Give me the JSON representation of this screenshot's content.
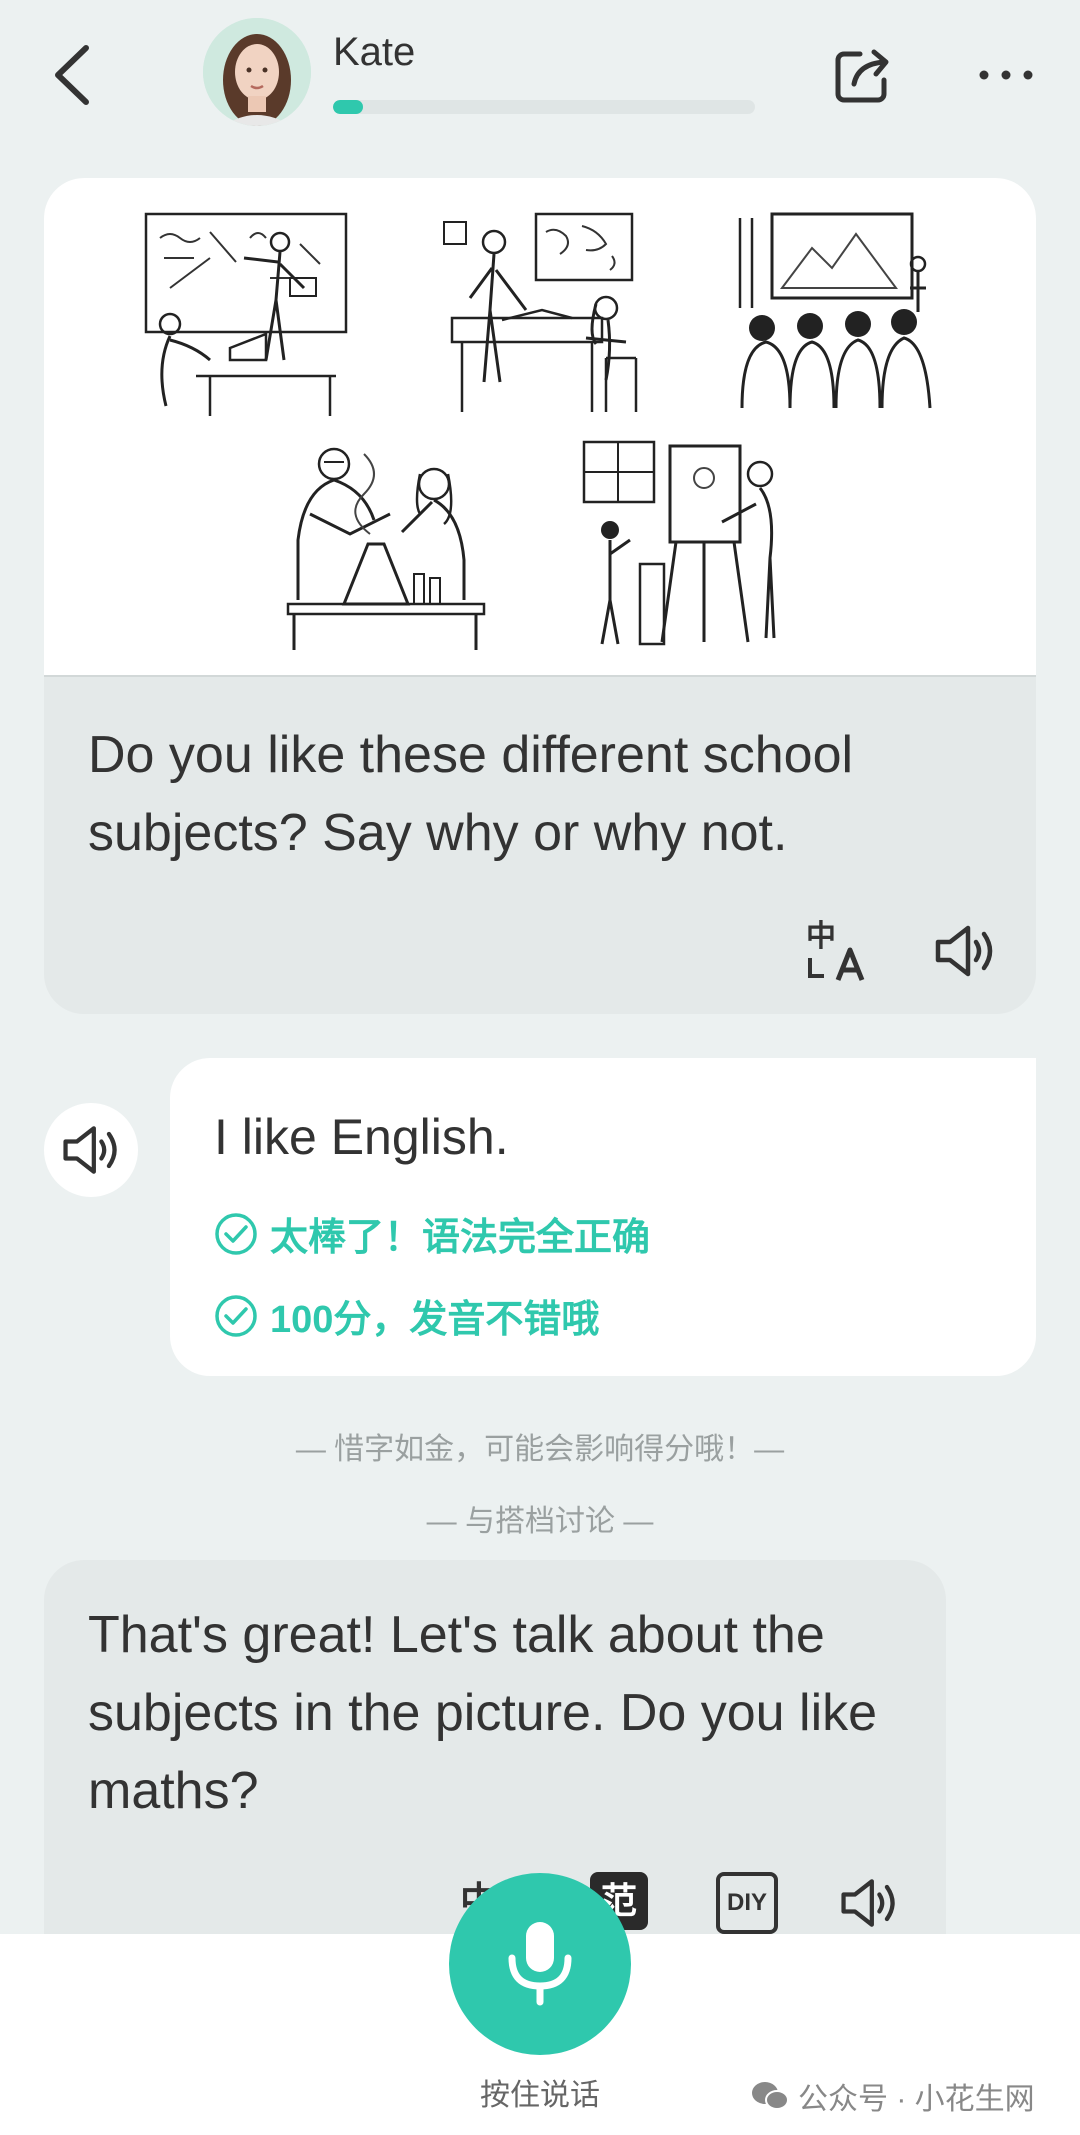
{
  "header": {
    "name": "Kate",
    "progress": 0.07,
    "accent": "#2fc8ad",
    "icons": [
      "back-icon",
      "avatar",
      "share-icon",
      "more-icon"
    ]
  },
  "question": {
    "text": "Do you like these different school subjects? Say why or why not.",
    "icons": [
      "translate-icon",
      "speaker-icon"
    ]
  },
  "answer": {
    "text": "I like English.",
    "feedback": [
      "太棒了！语法完全正确",
      "100分，发音不错哦"
    ]
  },
  "hints": {
    "h1": "— 惜字如金，可能会影响得分哦！—",
    "h2": "— 与搭档讨论 —"
  },
  "reply": {
    "text": "That's great! Let's talk about the subjects in the picture. Do you like maths?",
    "tool_fan": "范",
    "tool_zh": "中",
    "tool_diy": "DIY"
  },
  "bottom": {
    "mic_label": "按住说话",
    "watermark": "公众号 · 小花生网"
  }
}
